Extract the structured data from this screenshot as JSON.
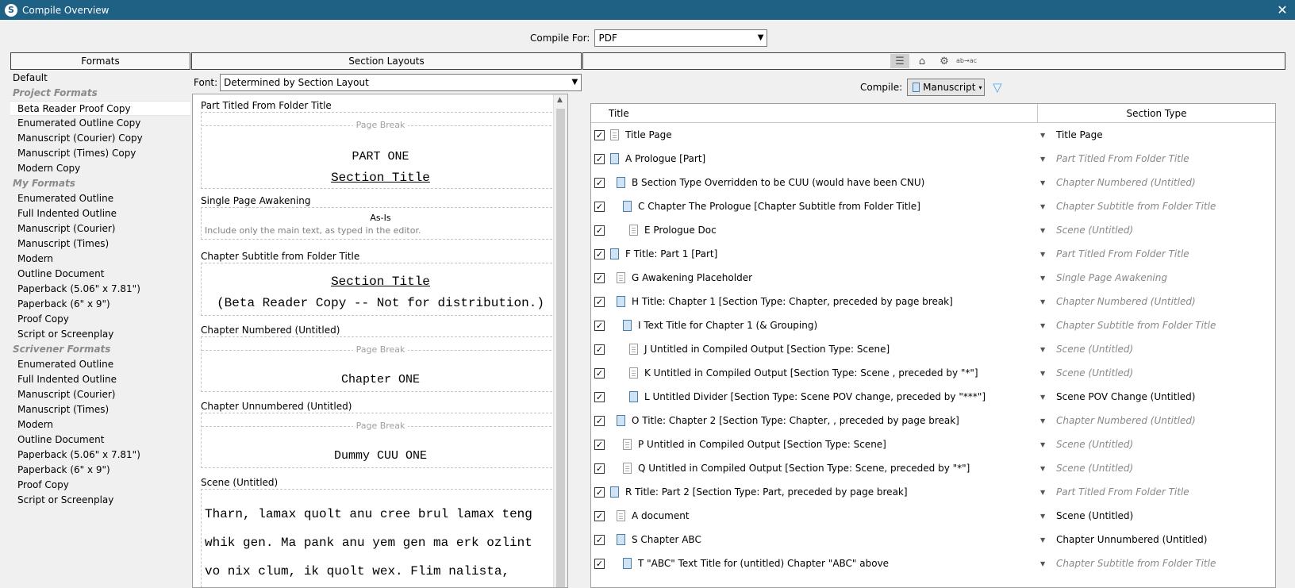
{
  "window": {
    "title": "Compile Overview",
    "close_glyph": "✕"
  },
  "compile_for": {
    "label": "Compile For:",
    "value": "PDF"
  },
  "columns": {
    "formats": "Formats",
    "section_layouts": "Section Layouts"
  },
  "formats": {
    "default": "Default",
    "groups": [
      {
        "name": "Project Formats",
        "items": [
          "Beta Reader Proof Copy",
          "Enumerated Outline Copy",
          "Manuscript (Courier) Copy",
          "Manuscript (Times) Copy",
          "Modern Copy"
        ]
      },
      {
        "name": "My Formats",
        "items": [
          "Enumerated Outline",
          "Full Indented Outline",
          "Manuscript (Courier)",
          "Manuscript (Times)",
          "Modern",
          "Outline Document",
          "Paperback (5.06\" x 7.81\")",
          "Paperback (6\" x 9\")",
          "Proof Copy",
          "Script or Screenplay"
        ]
      },
      {
        "name": "Scrivener Formats",
        "items": [
          "Enumerated Outline",
          "Full Indented Outline",
          "Manuscript (Courier)",
          "Manuscript (Times)",
          "Modern",
          "Outline Document",
          "Paperback (5.06\" x 7.81\")",
          "Paperback (6\" x 9\")",
          "Proof Copy",
          "Script or Screenplay"
        ]
      }
    ],
    "selected": "Beta Reader Proof Copy"
  },
  "layouts": {
    "font_label": "Font:",
    "font_value": "Determined by Section Layout",
    "page_break": "Page Break",
    "items": {
      "part_titled": {
        "title": "Part Titled From Folder Title",
        "line1": "PART ONE",
        "line2": "Section Title"
      },
      "single_page": {
        "title": "Single Page Awakening",
        "line1": "As-Is",
        "line2": "Include only the main text, as typed in the editor."
      },
      "chapter_subtitle": {
        "title": "Chapter Subtitle from Folder Title",
        "line1": "Section Title",
        "line2": "(Beta Reader Copy -- Not for distribution.)"
      },
      "chapter_numbered": {
        "title": "Chapter Numbered (Untitled)",
        "line1": "Chapter ONE"
      },
      "chapter_unnumbered": {
        "title": "Chapter Unnumbered (Untitled)",
        "line1": "Dummy CUU ONE"
      },
      "scene": {
        "title": "Scene (Untitled)",
        "lines": [
          "Tharn, lamax quolt anu cree brul lamax teng",
          "whik gen. Ma pank anu yem gen ma erk ozlint",
          "vo nix clum, ik quolt wex. Flim nalista,"
        ]
      }
    }
  },
  "right": {
    "toolbar_icons": [
      "list-icon",
      "tag-icon",
      "gear-icon",
      "replace-icon"
    ],
    "toolbar_glyphs": {
      "replace": "ab→ac"
    },
    "compile_label": "Compile:",
    "compile_value": "Manuscript",
    "outline_headers": {
      "title": "Title",
      "section_type": "Section Type"
    },
    "rows": [
      {
        "title": "Title Page",
        "type": "Title Page",
        "icon": "doc",
        "indent": 0,
        "typeItalic": false
      },
      {
        "title": "A Prologue [Part]",
        "type": "Part Titled From Folder Title",
        "icon": "folder",
        "indent": 0,
        "typeItalic": true
      },
      {
        "title": "B Section Type Overridden to be CUU (would have been  CNU)",
        "type": "Chapter Numbered (Untitled)",
        "icon": "folder",
        "indent": 1,
        "typeItalic": true
      },
      {
        "title": "C Chapter The Prologue [Chapter Subtitle from Folder Title]",
        "type": "Chapter Subtitle from Folder Title",
        "icon": "folder",
        "indent": 2,
        "typeItalic": true
      },
      {
        "title": "E Prologue Doc",
        "type": "Scene (Untitled)",
        "icon": "doc",
        "indent": 3,
        "typeItalic": true
      },
      {
        "title": "F Title: Part 1 [Part]",
        "type": "Part Titled From Folder Title",
        "icon": "folder",
        "indent": 0,
        "typeItalic": true
      },
      {
        "title": "G Awakening Placeholder",
        "type": "Single Page Awakening",
        "icon": "doc",
        "indent": 1,
        "typeItalic": true
      },
      {
        "title": "H Title: Chapter 1 [Section Type: Chapter, preceded by page break]",
        "type": "Chapter Numbered (Untitled)",
        "icon": "folder",
        "indent": 1,
        "typeItalic": true
      },
      {
        "title": "I Text Title for Chapter 1 (& Grouping)",
        "type": "Chapter Subtitle from Folder Title",
        "icon": "folder",
        "indent": 2,
        "typeItalic": true
      },
      {
        "title": "J Untitled in Compiled Output [Section Type: Scene]",
        "type": "Scene (Untitled)",
        "icon": "doc",
        "indent": 3,
        "typeItalic": true
      },
      {
        "title": "K Untitled in Compiled Output [Section Type: Scene , preceded by \"*\"]",
        "type": "Scene (Untitled)",
        "icon": "doc",
        "indent": 3,
        "typeItalic": true
      },
      {
        "title": "L Untitled Divider [Section Type: Scene POV change, preceded by \"***\"]",
        "type": "Scene POV Change (Untitled)",
        "icon": "snap",
        "indent": 3,
        "typeItalic": false
      },
      {
        "title": "O Title: Chapter 2 [Section Type: Chapter, , preceded by page break]",
        "type": "Chapter Numbered (Untitled)",
        "icon": "folder",
        "indent": 1,
        "typeItalic": true
      },
      {
        "title": "P Untitled in Compiled Output [Section Type: Scene]",
        "type": "Scene (Untitled)",
        "icon": "doc",
        "indent": 2,
        "typeItalic": true
      },
      {
        "title": "Q Untitled in Compiled Output [Section Type: Scene, preceded by \"*\"]",
        "type": "Scene (Untitled)",
        "icon": "doc",
        "indent": 2,
        "typeItalic": true
      },
      {
        "title": "R Title: Part 2 [Section Type: Part, preceded by page break]",
        "type": "Part Titled From Folder Title",
        "icon": "folder",
        "indent": 0,
        "typeItalic": true
      },
      {
        "title": "A document",
        "type": "Scene (Untitled)",
        "icon": "doc",
        "indent": 1,
        "typeItalic": false
      },
      {
        "title": "S Chapter ABC",
        "type": "Chapter Unnumbered (Untitled)",
        "icon": "folder",
        "indent": 1,
        "typeItalic": false
      },
      {
        "title": "T \"ABC\" Text Title for (untitled) Chapter \"ABC\" above",
        "type": "Chapter Subtitle from Folder Title",
        "icon": "folder",
        "indent": 2,
        "typeItalic": true
      }
    ]
  }
}
